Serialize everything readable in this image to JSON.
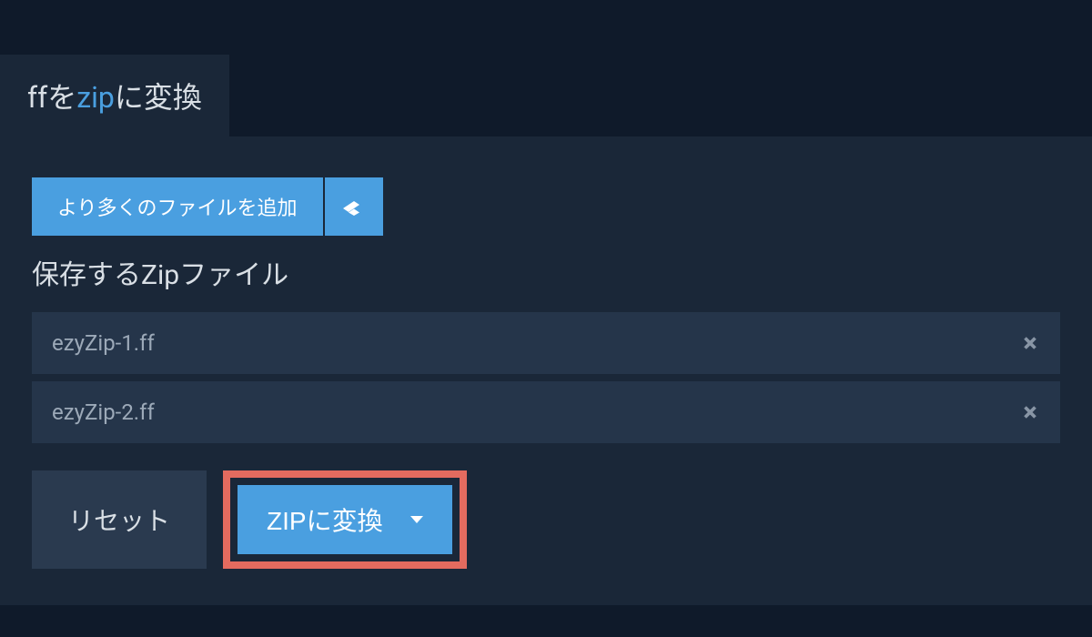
{
  "tab": {
    "prefix": "ff",
    "middle1": "を",
    "highlight": "zip",
    "suffix": "に変換"
  },
  "actions": {
    "add_more_files": "より多くのファイルを追加"
  },
  "section": {
    "zip_file_label": "保存するZipファイル"
  },
  "files": [
    {
      "name": "ezyZip-1.ff"
    },
    {
      "name": "ezyZip-2.ff"
    }
  ],
  "buttons": {
    "reset": "リセット",
    "convert": "ZIPに変換"
  }
}
